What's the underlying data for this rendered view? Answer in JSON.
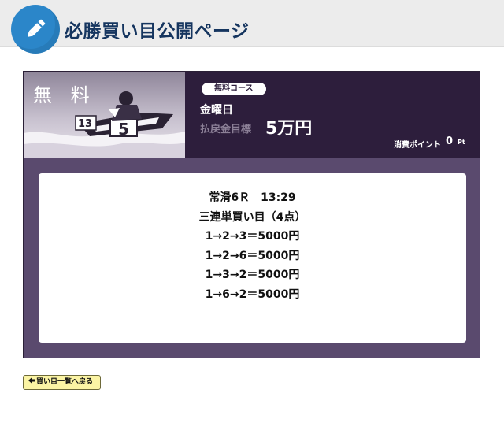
{
  "header": {
    "title": "必勝買い目公開ページ",
    "logo_icon": "pencil-icon"
  },
  "card": {
    "free_label": "無 料",
    "course_badge": "無料コース",
    "day": "金曜日",
    "target_label": "払戻金目標",
    "target_value": "5万円",
    "points_label": "消費ポイント",
    "points_value": "0",
    "points_unit": "Pt",
    "boat_numbers": [
      "13",
      "5"
    ]
  },
  "tips": {
    "race": "常滑6Ｒ　13:29",
    "bet_type": "三連単買い目（4点）",
    "bets": [
      "1→2→3＝5000円",
      "1→2→6＝5000円",
      "1→3→2＝5000円",
      "1→6→2＝5000円"
    ]
  },
  "footer": {
    "back_label": "買い目一覧へ戻る",
    "back_icon": "arrow-left-icon"
  },
  "colors": {
    "header_bg": "#ececec",
    "title_text": "#15355f",
    "logo_blue": "#2b86c9",
    "band_dark": "#2d1e3c",
    "card_purple": "#5a4a6e",
    "button_yellow": "#fbf4a4"
  }
}
